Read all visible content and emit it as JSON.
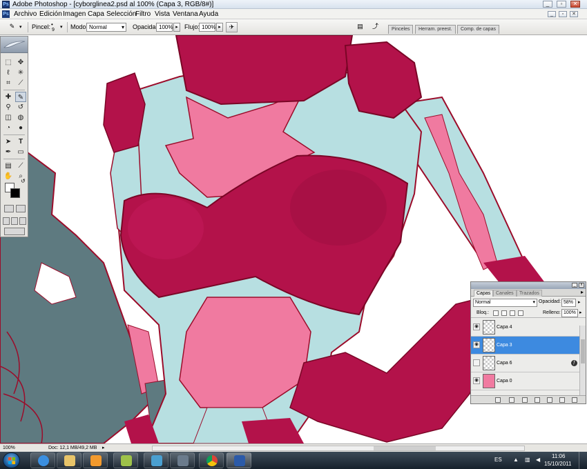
{
  "window": {
    "title": "Adobe Photoshop - [cyborglinea2.psd al 100% (Capa 3, RGB/8#)]",
    "controls": [
      "minimize-icon",
      "restore-icon",
      "close-icon"
    ]
  },
  "menu": {
    "items": [
      "Archivo",
      "Edición",
      "Imagen",
      "Capa",
      "Selección",
      "Filtro",
      "Vista",
      "Ventana",
      "Ayuda"
    ],
    "doc_controls": [
      "minimize-icon",
      "restore-icon",
      "close-icon"
    ]
  },
  "options": {
    "brush_label": "Pincel:",
    "brush_size": "9",
    "mode_label": "Modo:",
    "mode_value": "Normal",
    "opacity_label": "Opacidad:",
    "opacity_value": "100%",
    "flow_label": "Flujo:",
    "flow_value": "100%",
    "dock_tabs": [
      "Pinceles",
      "Herram. preest.",
      "Comp. de capas"
    ]
  },
  "toolbox": {
    "tools": [
      "marquee-icon",
      "move-icon",
      "lasso-icon",
      "magic-wand-icon",
      "crop-icon",
      "slice-icon",
      "healing-brush-icon",
      "brush-icon",
      "clone-stamp-icon",
      "history-brush-icon",
      "eraser-icon",
      "paint-bucket-icon",
      "blur-icon",
      "dodge-icon",
      "path-selection-icon",
      "type-icon",
      "pen-icon",
      "shape-icon",
      "notes-icon",
      "eyedropper-icon",
      "hand-icon",
      "zoom-icon"
    ],
    "active_tool": "brush-icon",
    "foreground_color": "#ffffff",
    "background_color": "#000000"
  },
  "status": {
    "zoom": "100%",
    "doc_size": "Doc: 12,1 MB/49,2 MB"
  },
  "layers_panel": {
    "tabs": [
      "Capas",
      "Canales",
      "Trazados"
    ],
    "active_tab": "Capas",
    "blend_mode": "Normal",
    "opacity_label": "Opacidad:",
    "opacity_value": "58%",
    "lock_label": "Bloq.:",
    "fill_label": "Relleno:",
    "fill_value": "100%",
    "layers": [
      {
        "name": "Capa 4",
        "visible": true,
        "active": false
      },
      {
        "name": "Capa 3",
        "visible": true,
        "active": true
      },
      {
        "name": "Capa 6",
        "visible": false,
        "active": false,
        "has_effect": true
      },
      {
        "name": "Capa 0",
        "visible": true,
        "active": false
      }
    ]
  },
  "taskbar": {
    "apps": [
      "internet-explorer-icon",
      "explorer-folder-icon",
      "media-player-icon",
      "tool-app-icon",
      "messenger-icon",
      "video-app-icon",
      "chrome-icon",
      "photoshop-icon"
    ],
    "language": "ES",
    "time": "11:06",
    "date": "15/10/2011"
  },
  "colors": {
    "magenta": "#b3124a",
    "pink": "#f07aa0",
    "cyan": "#b7dfe1",
    "gray_teal": "#5e7a80",
    "selection_blue": "#3d8ae0"
  }
}
